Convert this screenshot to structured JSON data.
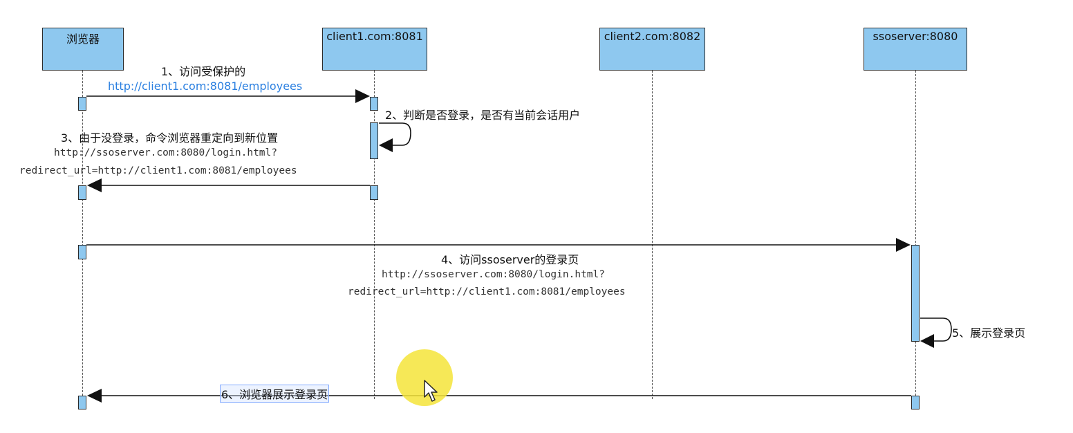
{
  "participants": {
    "browser": "浏览器",
    "client1": "client1.com:8081",
    "client2": "client2.com:8082",
    "ssoserver": "ssoserver:8080"
  },
  "messages": {
    "m1_title": "1、访问受保护的",
    "m1_url": "http://client1.com:8081/employees",
    "m2": "2、判断是否登录，是否有当前会话用户",
    "m3_title": "3、由于没登录，命令浏览器重定向到新位置",
    "m3_url_line1": "http://ssoserver.com:8080/login.html?",
    "m3_url_line2": "redirect_url=http://client1.com:8081/employees",
    "m4_title": "4、访问ssoserver的登录页",
    "m4_url_line1": "http://ssoserver.com:8080/login.html?",
    "m4_url_line2": "redirect_url=http://client1.com:8081/employees",
    "m5": "5、展示登录页",
    "m6": "6、浏览器展示登录页"
  },
  "colors": {
    "participant_fill": "#8ec8ef",
    "link_text": "#2a7fe0",
    "cursor_highlight": "#f5e43a"
  },
  "icons": {
    "cursor": "mouse-pointer-icon"
  }
}
